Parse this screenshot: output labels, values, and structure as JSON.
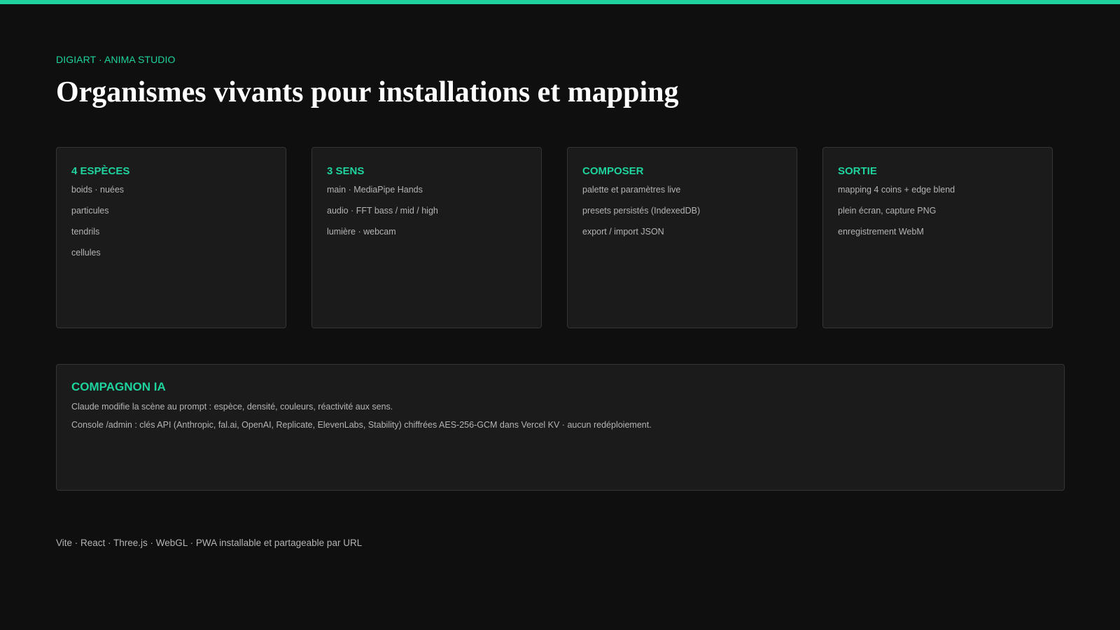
{
  "accent_color": "#1ed39e",
  "header": {
    "eyebrow": "DIGIART · ANIMA STUDIO",
    "title": "Organismes vivants pour installations et mapping"
  },
  "cards": [
    {
      "title": "4 ESPÈCES",
      "items": [
        "boids · nuées",
        "particules",
        "tendrils",
        "cellules"
      ]
    },
    {
      "title": "3 SENS",
      "items": [
        "main · MediaPipe Hands",
        "audio · FFT bass / mid / high",
        "lumière · webcam"
      ]
    },
    {
      "title": "COMPOSER",
      "items": [
        "palette et paramètres live",
        "presets persistés (IndexedDB)",
        "export / import JSON"
      ]
    },
    {
      "title": "SORTIE",
      "items": [
        "mapping 4 coins + edge blend",
        "plein écran, capture PNG",
        "enregistrement WebM"
      ]
    }
  ],
  "companion": {
    "title": "COMPAGNON IA",
    "lines": [
      "Claude modifie la scène au prompt : espèce, densité, couleurs, réactivité aux sens.",
      "Console /admin : clés API (Anthropic, fal.ai, OpenAI, Replicate, ElevenLabs, Stability) chiffrées AES-256-GCM dans Vercel KV · aucun redéploiement."
    ]
  },
  "footer": {
    "text": "Vite · React · Three.js · WebGL · PWA installable et partageable par URL"
  }
}
